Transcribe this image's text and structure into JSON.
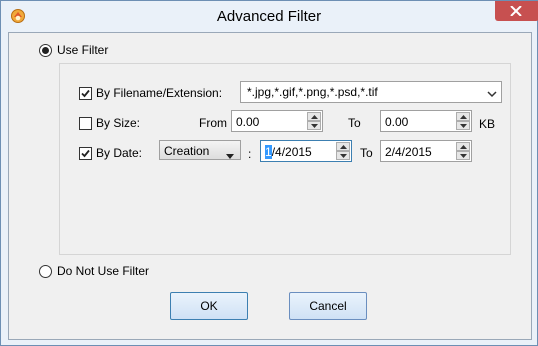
{
  "window": {
    "title": "Advanced Filter"
  },
  "use_filter": {
    "label": "Use Filter",
    "selected": true
  },
  "not_use_filter": {
    "label": "Do Not Use Filter",
    "selected": false
  },
  "filename": {
    "label": "By Filename/Extension:",
    "checked": true,
    "value": "*.jpg,*.gif,*.png,*.psd,*.tif"
  },
  "size": {
    "label": "By Size:",
    "checked": false,
    "from_label": "From",
    "from_value": "0.00",
    "to_label": "To",
    "to_value": "0.00",
    "unit": "KB"
  },
  "date": {
    "label": "By Date:",
    "checked": true,
    "type_value": "Creation",
    "colon": ":",
    "from_first_char": "1",
    "from_rest": "/4/2015",
    "to_label": "To",
    "to_value": "2/4/2015"
  },
  "buttons": {
    "ok": "OK",
    "cancel": "Cancel"
  },
  "colors": {
    "close_button": "#c75050",
    "title_background": "#eaf1f9",
    "dialog_background": "#f0f0f0",
    "button_border": "#6a8ebf",
    "selection": "#3399ff"
  }
}
